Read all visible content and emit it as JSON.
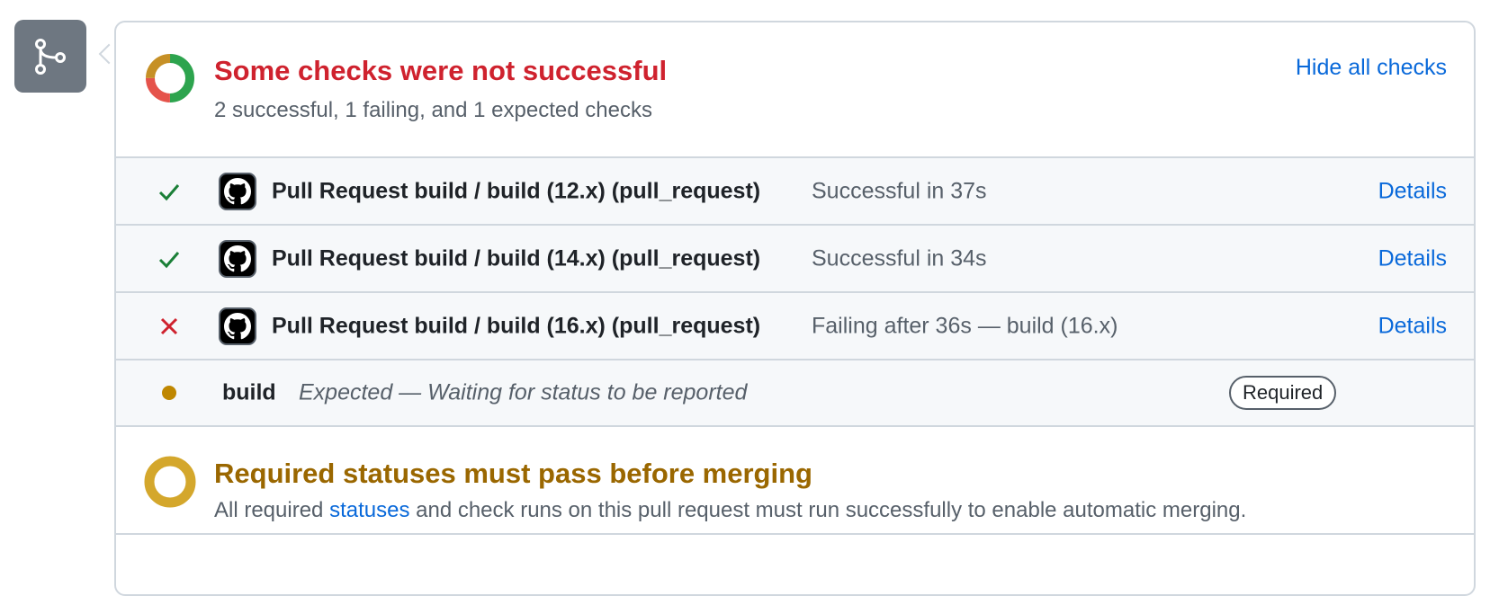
{
  "summary": {
    "title": "Some checks were not successful",
    "subtitle": "2 successful, 1 failing, and 1 expected checks",
    "hide_link": "Hide all checks"
  },
  "checks": [
    {
      "status": "success",
      "icon": "check-icon",
      "name": "Pull Request build / build (12.x) (pull_request)",
      "desc": "Successful in 37s",
      "details": "Details"
    },
    {
      "status": "success",
      "icon": "check-icon",
      "name": "Pull Request build / build (14.x) (pull_request)",
      "desc": "Successful in 34s",
      "details": "Details"
    },
    {
      "status": "failure",
      "icon": "x-icon",
      "name": "Pull Request build / build (16.x) (pull_request)",
      "desc": "Failing after 36s — build (16.x)",
      "details": "Details"
    },
    {
      "status": "pending",
      "icon": "dot-icon",
      "name": "build",
      "desc": "Expected — Waiting for status to be reported",
      "badge": "Required"
    }
  ],
  "merge": {
    "title": "Required statuses must pass before merging",
    "desc_before": "All required ",
    "desc_link": "statuses",
    "desc_after": " and check runs on this pull request must run successfully to enable automatic merging."
  },
  "colors": {
    "success": "#1a7f37",
    "failure": "#cf222e",
    "pending": "#bf8700",
    "link": "#0969da",
    "merge_title": "#9a6700"
  }
}
